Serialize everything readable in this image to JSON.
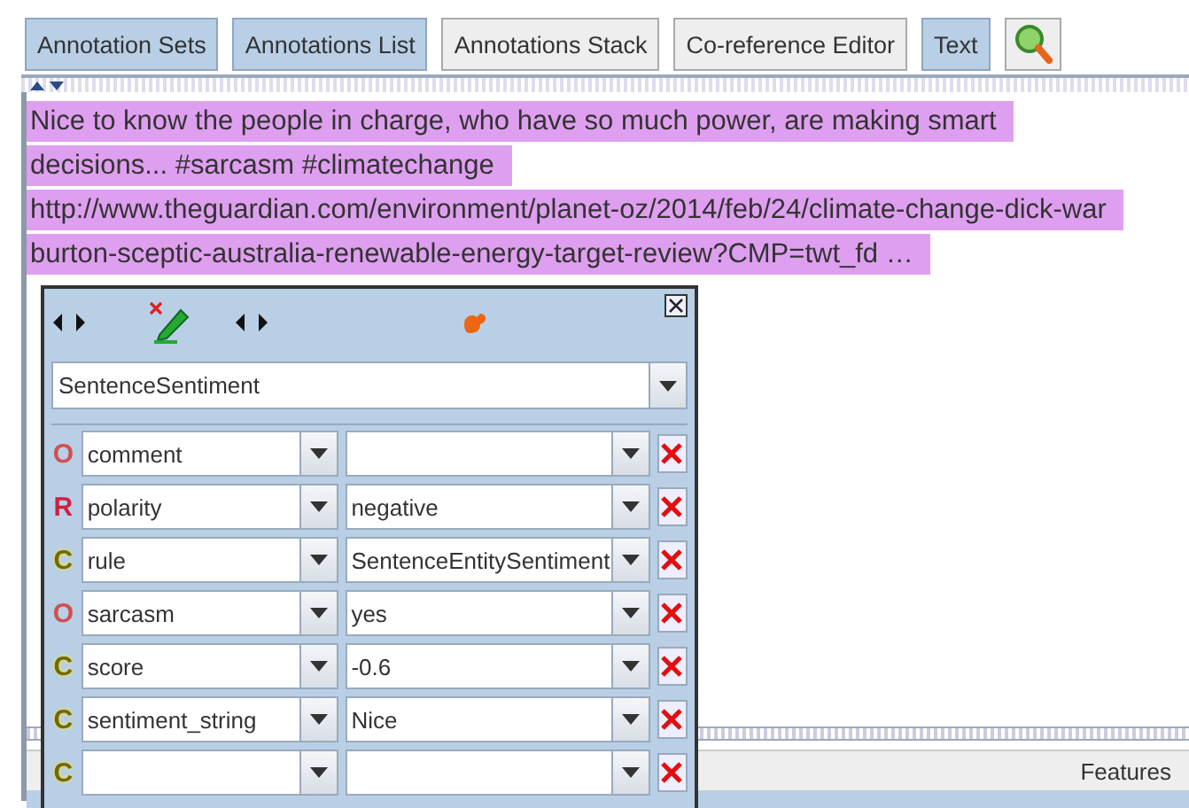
{
  "toolbar": {
    "buttons": [
      {
        "label": "Annotation Sets",
        "selected": true
      },
      {
        "label": "Annotations List",
        "selected": true
      },
      {
        "label": "Annotations Stack",
        "selected": false
      },
      {
        "label": "Co-reference Editor",
        "selected": false
      },
      {
        "label": "Text",
        "selected": true
      }
    ]
  },
  "text_lines": [
    "Nice to know the people in charge, who have so much power, are making smart",
    "decisions... #sarcasm #climatechange",
    "http://www.theguardian.com/environment/planet-oz/2014/feb/24/climate-change-dick-war",
    "burton-sceptic-australia-renewable-energy-target-review?CMP=twt_fd …"
  ],
  "editor": {
    "type": "SentenceSentiment",
    "features": [
      {
        "kind": "optional",
        "marker": "O",
        "name": "comment"
      },
      {
        "kind": "required",
        "marker": "R",
        "name": "polarity",
        "value": "negative"
      },
      {
        "kind": "custom",
        "marker": "C",
        "name": "rule",
        "value": "SentenceEntitySentiment"
      },
      {
        "kind": "optional",
        "marker": "O",
        "name": "sarcasm",
        "value": "yes"
      },
      {
        "kind": "custom",
        "marker": "C",
        "name": "score",
        "value": "-0.6"
      },
      {
        "kind": "custom",
        "marker": "C",
        "name": "sentiment_string",
        "value": "Nice"
      },
      {
        "kind": "custom",
        "marker": "C"
      }
    ]
  },
  "table": {
    "columns": [
      "Features"
    ]
  }
}
